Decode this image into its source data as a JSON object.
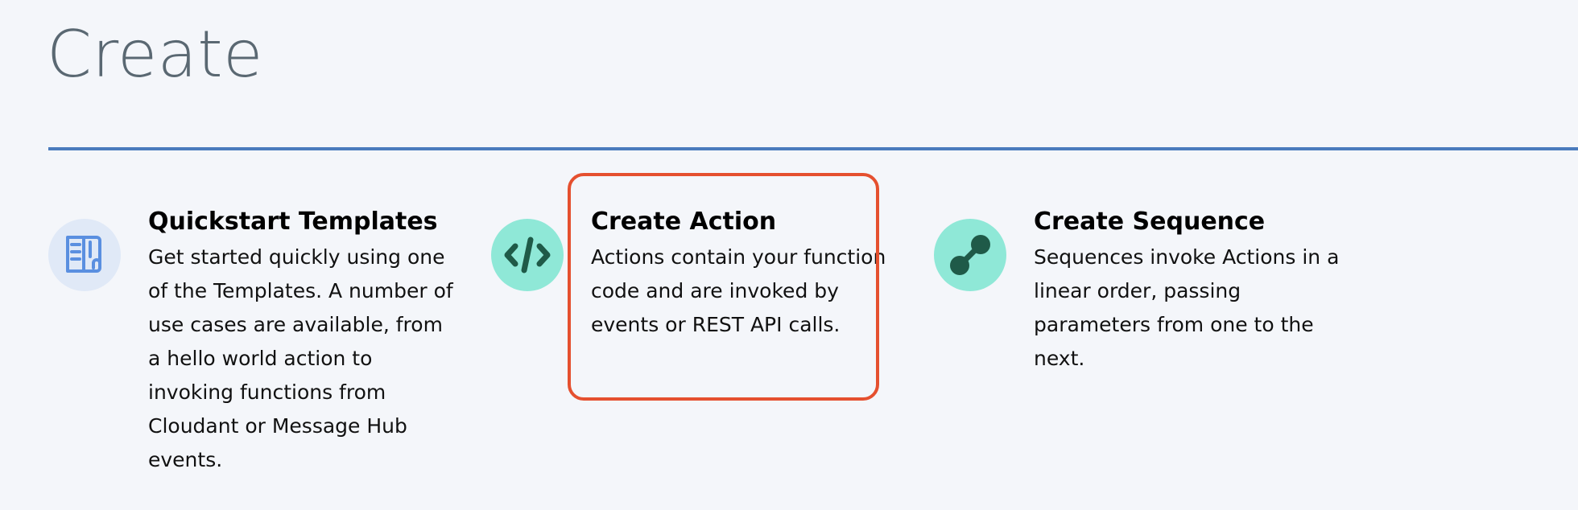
{
  "page": {
    "title": "Create"
  },
  "colors": {
    "accent_rule": "#4a7bbd",
    "highlight": "#e5502f",
    "icon_blue_bg": "#e0e9f7",
    "icon_blue_fg": "#5a8fe0",
    "icon_teal_bg": "#8fe8d7",
    "icon_teal_fg": "#1f5a48"
  },
  "cards": [
    {
      "id": "quickstart-templates",
      "title": "Quickstart Templates",
      "description": "Get started quickly using one of the Templates. A number of use cases are available, from a hello world action to invoking functions from Cloudant or Message Hub events.",
      "icon": "book-icon"
    },
    {
      "id": "create-action",
      "title": "Create Action",
      "description": "Actions contain your function code and are invoked by events or REST API calls.",
      "icon": "code-icon"
    },
    {
      "id": "create-sequence",
      "title": "Create Sequence",
      "description": "Sequences invoke Actions in a linear order, passing parameters from one to the next.",
      "icon": "sequence-icon"
    }
  ]
}
